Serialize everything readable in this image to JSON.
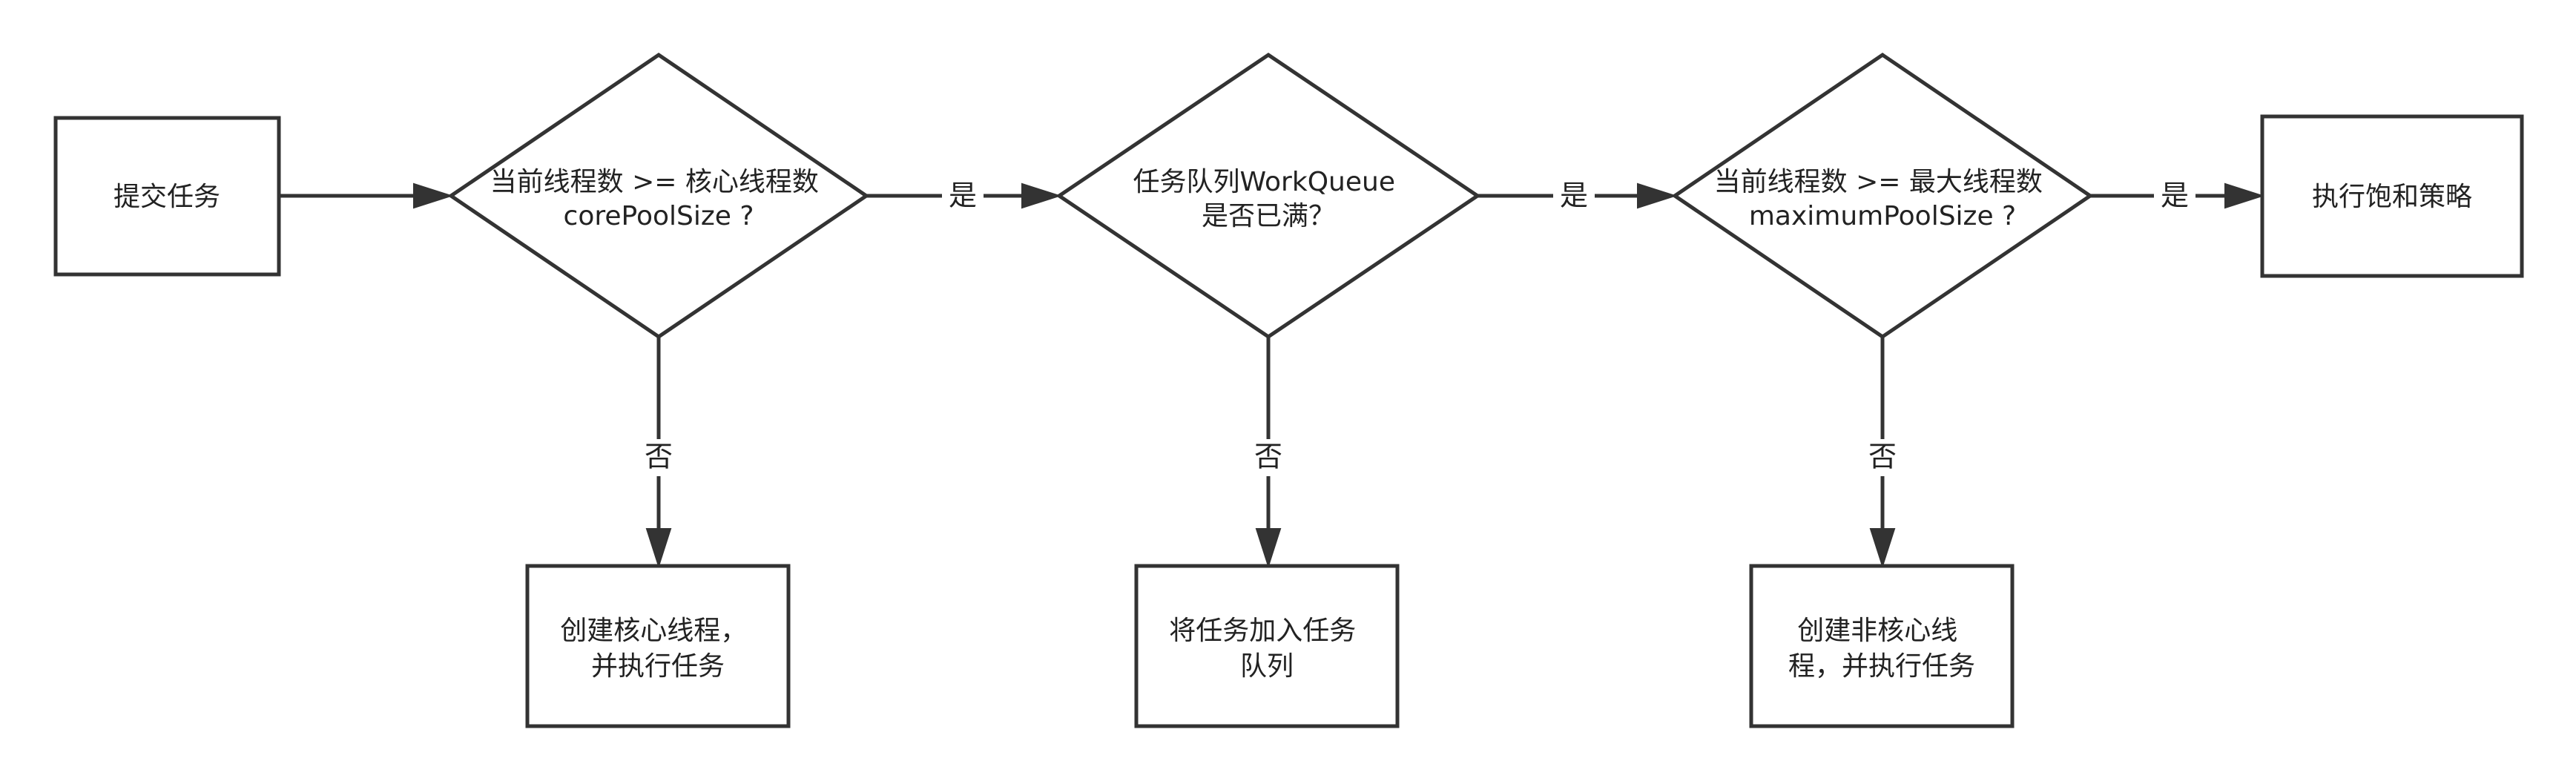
{
  "nodes": {
    "submit": {
      "lines": [
        "提交任务"
      ]
    },
    "check_core": {
      "lines": [
        "当前线程数 >= 核心线程数",
        "corePoolSize ?"
      ]
    },
    "check_queue": {
      "lines": [
        "任务队列WorkQueue",
        "是否已满？"
      ]
    },
    "check_max": {
      "lines": [
        "当前线程数 >= 最大线程数",
        "maximumPoolSize ?"
      ]
    },
    "reject": {
      "lines": [
        "执行饱和策略"
      ]
    },
    "create_core": {
      "lines": [
        "创建核心线程，",
        "并执行任务"
      ]
    },
    "enqueue": {
      "lines": [
        "将任务加入任务",
        "队列"
      ]
    },
    "create_noncore": {
      "lines": [
        "创建非核心线",
        "程，并执行任务"
      ]
    }
  },
  "edges": {
    "yes_1": "是",
    "yes_2": "是",
    "yes_3": "是",
    "no_1": "否",
    "no_2": "否",
    "no_3": "否"
  }
}
